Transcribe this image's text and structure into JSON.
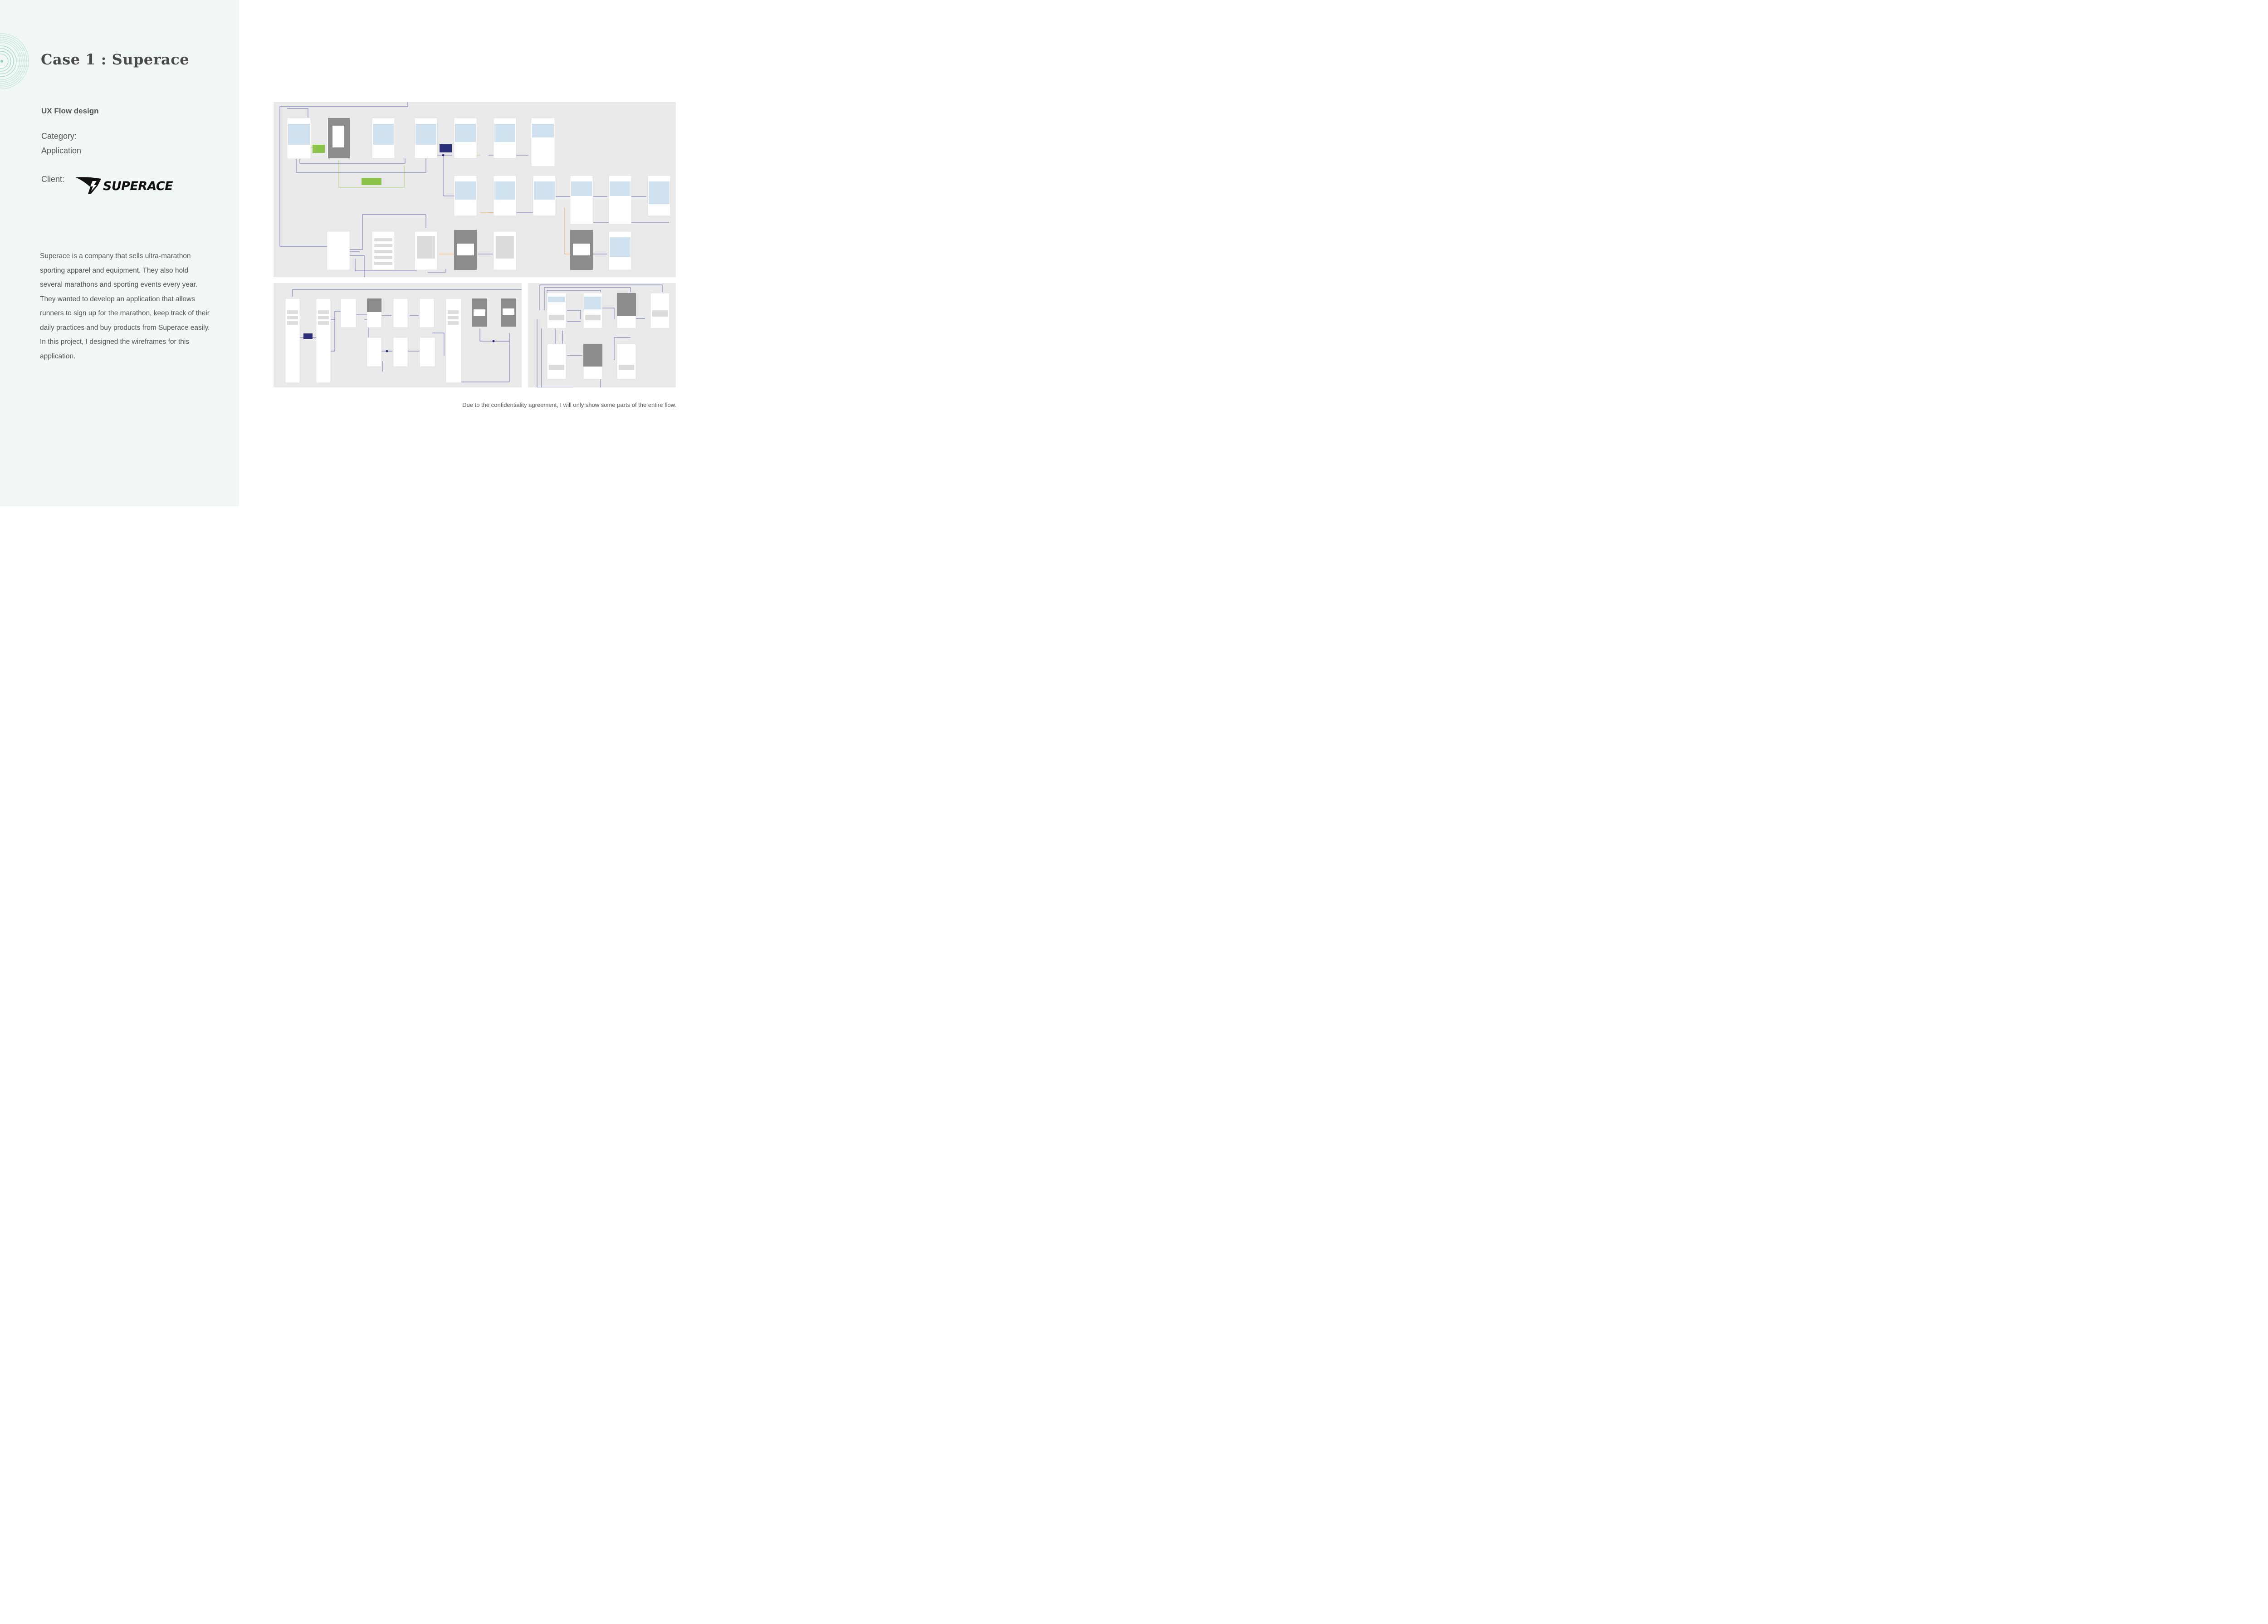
{
  "title": "Case 1 : Superace",
  "subtitle": "UX Flow design",
  "category": {
    "label": "Category:",
    "value": "Application"
  },
  "client": {
    "label": "Client:",
    "logo_text": "SUPERACE"
  },
  "description": "Superace is a company that sells ultra-marathon sporting apparel and equipment. They also hold several marathons and sporting events every year. They wanted to develop an application that allows runners to sign up for the marathon, keep track of their daily practices and buy products from Superace easily. In this project, I designed the wireframes for this application.",
  "caption": "Due to the confidentiality agreement, I will only show some parts of the entire flow.",
  "colors": {
    "left_bg": "#f1f7f5",
    "accent_teal": "#8fcfbf",
    "flow_bg": "#eaeaea",
    "note_green": "#8bc34a",
    "note_navy": "#2b2f7a",
    "connector_blue": "#3b3f9a",
    "connector_orange": "#f0a040"
  }
}
